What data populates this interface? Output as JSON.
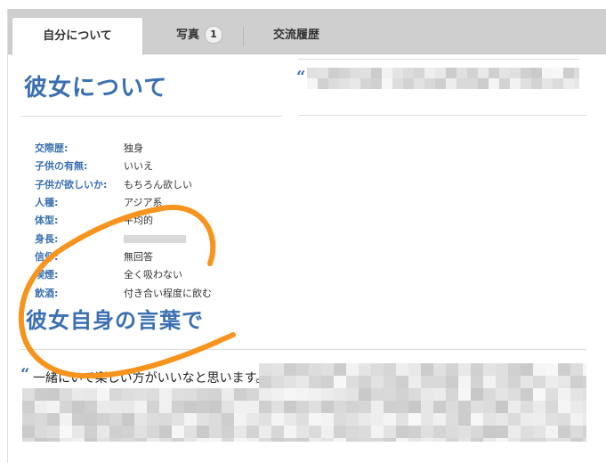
{
  "tabs": [
    {
      "label": "自分について",
      "badge": ""
    },
    {
      "label": "写真",
      "badge": "1"
    },
    {
      "label": "交流履歴",
      "badge": ""
    }
  ],
  "about": {
    "heading": "彼女について",
    "quote_mark": "“",
    "profile": [
      {
        "label": "交際歴:",
        "value": "独身"
      },
      {
        "label": "子供の有無:",
        "value": "いいえ"
      },
      {
        "label": "子供が欲しいか:",
        "value": "もちろん欲しい"
      },
      {
        "label": "人種:",
        "value": "アジア系"
      },
      {
        "label": "体型:",
        "value": "平均的"
      },
      {
        "label": "身長:",
        "value": ""
      },
      {
        "label": "信仰:",
        "value": "無回答"
      },
      {
        "label": "喫煙:",
        "value": "全く吸わない"
      },
      {
        "label": "飲酒:",
        "value": "付き合い程度に飲む"
      }
    ]
  },
  "own_words": {
    "heading": "彼女自身の言葉で",
    "quote_mark": "“",
    "visible_text": "一緒にいて楽しい方がいいなと思います。"
  },
  "colors": {
    "accent_blue": "#3a6fb0",
    "annotation_orange": "#f7941d",
    "tab_bar": "#cfcfcf"
  }
}
